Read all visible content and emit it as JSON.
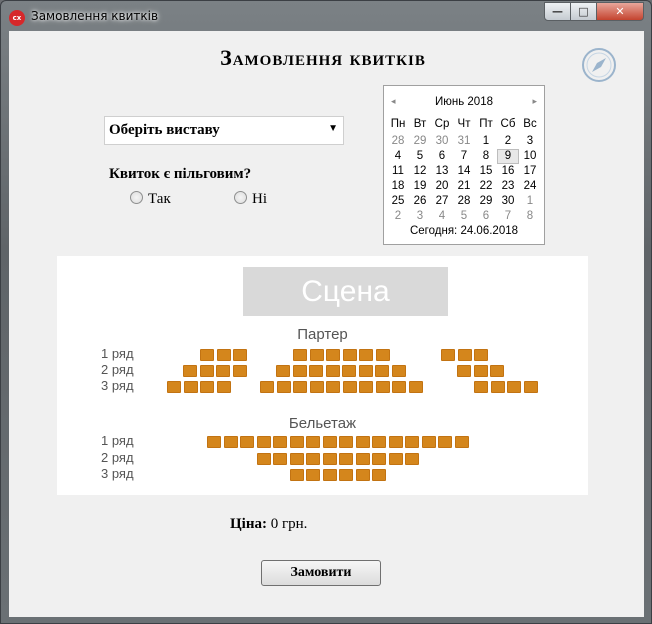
{
  "window": {
    "app_icon_text": "cx",
    "title": "Замовлення квитків",
    "min_glyph": "—",
    "max_glyph": "□",
    "close_glyph": "✕"
  },
  "form": {
    "heading": "Замовлення квитків",
    "play_select": {
      "value": "Оберіть виставу",
      "arrow": "▼"
    },
    "discount_question": "Квиток є пільговим?",
    "options": [
      "Так",
      "Ні"
    ],
    "price_label": "Ціна:",
    "price_value": "0 грн.",
    "submit_label": "Замовити"
  },
  "calendar": {
    "prev": "◂",
    "next": "▸",
    "month_label": "Июнь 2018",
    "weekdays": [
      "Пн",
      "Вт",
      "Ср",
      "Чт",
      "Пт",
      "Сб",
      "Вс"
    ],
    "weeks": [
      [
        "28",
        "29",
        "30",
        "31",
        "1",
        "2",
        "3"
      ],
      [
        "4",
        "5",
        "6",
        "7",
        "8",
        "9",
        "10"
      ],
      [
        "11",
        "12",
        "13",
        "14",
        "15",
        "16",
        "17"
      ],
      [
        "18",
        "19",
        "20",
        "21",
        "22",
        "23",
        "24"
      ],
      [
        "25",
        "26",
        "27",
        "28",
        "29",
        "30",
        "1"
      ],
      [
        "2",
        "3",
        "4",
        "5",
        "6",
        "7",
        "8"
      ]
    ],
    "selected_day": "9",
    "today_label": "Сегодня: 24.06.2018"
  },
  "hall": {
    "stage": "Сцена",
    "parter": {
      "title": "Партер",
      "rows": [
        {
          "label": "1 ряд",
          "blocks": [
            3,
            6,
            3
          ]
        },
        {
          "label": "2 ряд",
          "blocks": [
            4,
            8,
            3
          ]
        },
        {
          "label": "3 ряд",
          "blocks": [
            4,
            10,
            4
          ]
        }
      ]
    },
    "beletage": {
      "title": "Бельетаж",
      "rows": [
        {
          "label": "1 ряд",
          "seats": 16
        },
        {
          "label": "2 ряд",
          "seats": 10
        },
        {
          "label": "3 ряд",
          "seats": 6
        }
      ]
    }
  },
  "colors": {
    "seat": "#d4861c",
    "stage": "#d9d9d9"
  }
}
